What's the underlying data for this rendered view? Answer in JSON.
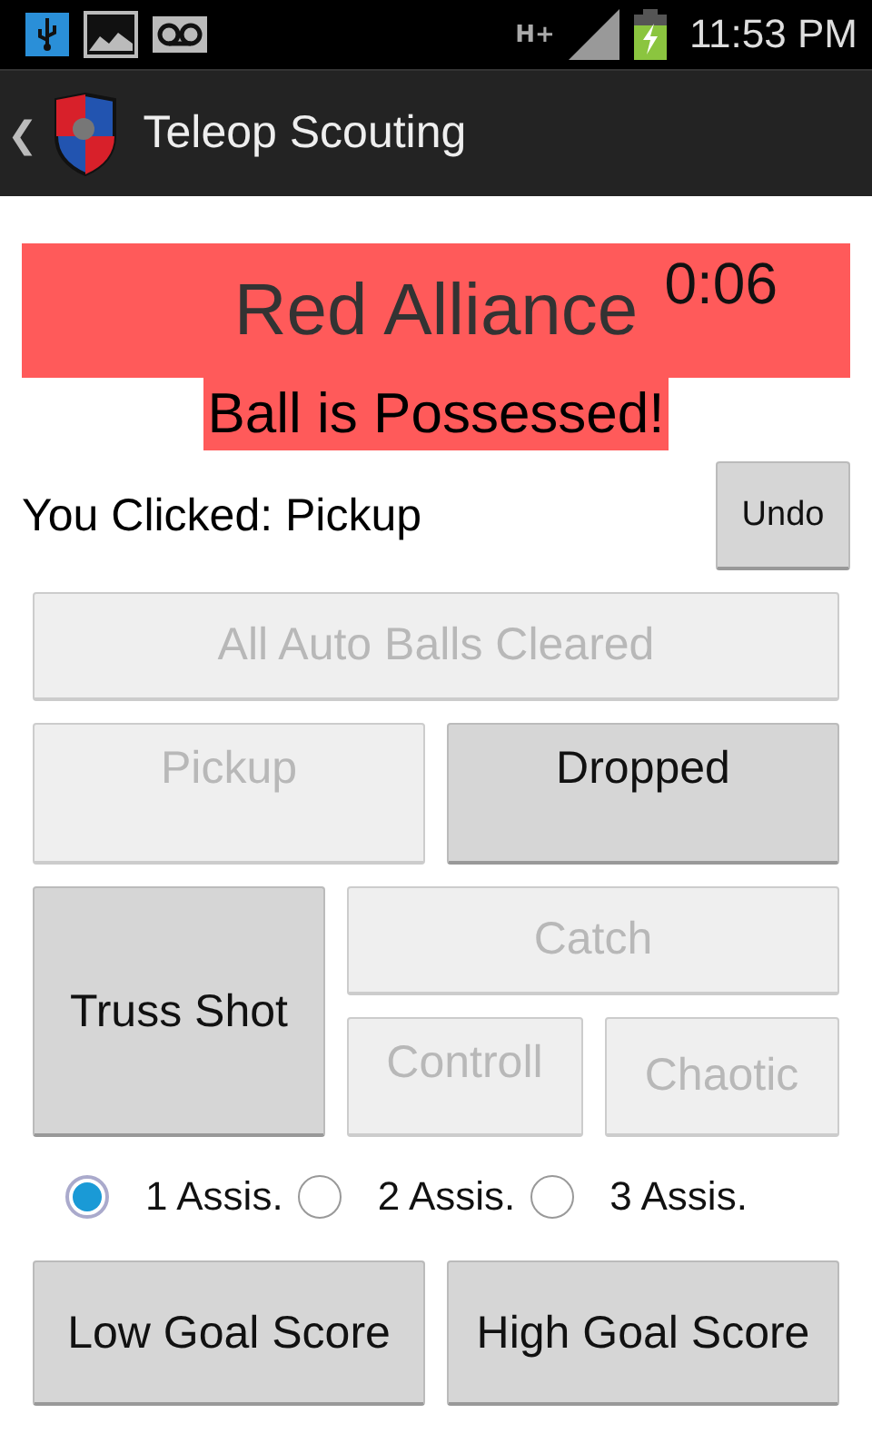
{
  "status_bar": {
    "network": "H+",
    "time": "11:53 PM"
  },
  "action_bar": {
    "back": "❮",
    "title": "Teleop Scouting"
  },
  "banner": {
    "alliance": "Red Alliance",
    "timer": "0:06",
    "color": "#ff5a5a"
  },
  "status_message": "Ball is Possessed!",
  "last_click": "You Clicked: Pickup",
  "undo": {
    "label": "Undo",
    "disabled": false
  },
  "buttons": [
    {
      "label": "All Auto Balls Cleared",
      "disabled": true
    },
    {
      "label": "Pickup",
      "disabled": true
    },
    {
      "label": "Dropped",
      "disabled": false
    },
    {
      "label": "Truss Shot",
      "disabled": false
    },
    {
      "label": "Catch",
      "disabled": true
    },
    {
      "label": "Controll",
      "disabled": true
    },
    {
      "label": "Chaotic",
      "disabled": true
    }
  ],
  "assists": [
    {
      "label": "1 Assis.",
      "selected": true
    },
    {
      "label": "2 Assis.",
      "selected": false
    },
    {
      "label": "3 Assis.",
      "selected": false
    }
  ],
  "score_buttons": [
    {
      "label": "Low Goal Score",
      "disabled": false
    },
    {
      "label": "High Goal Score",
      "disabled": false
    }
  ]
}
